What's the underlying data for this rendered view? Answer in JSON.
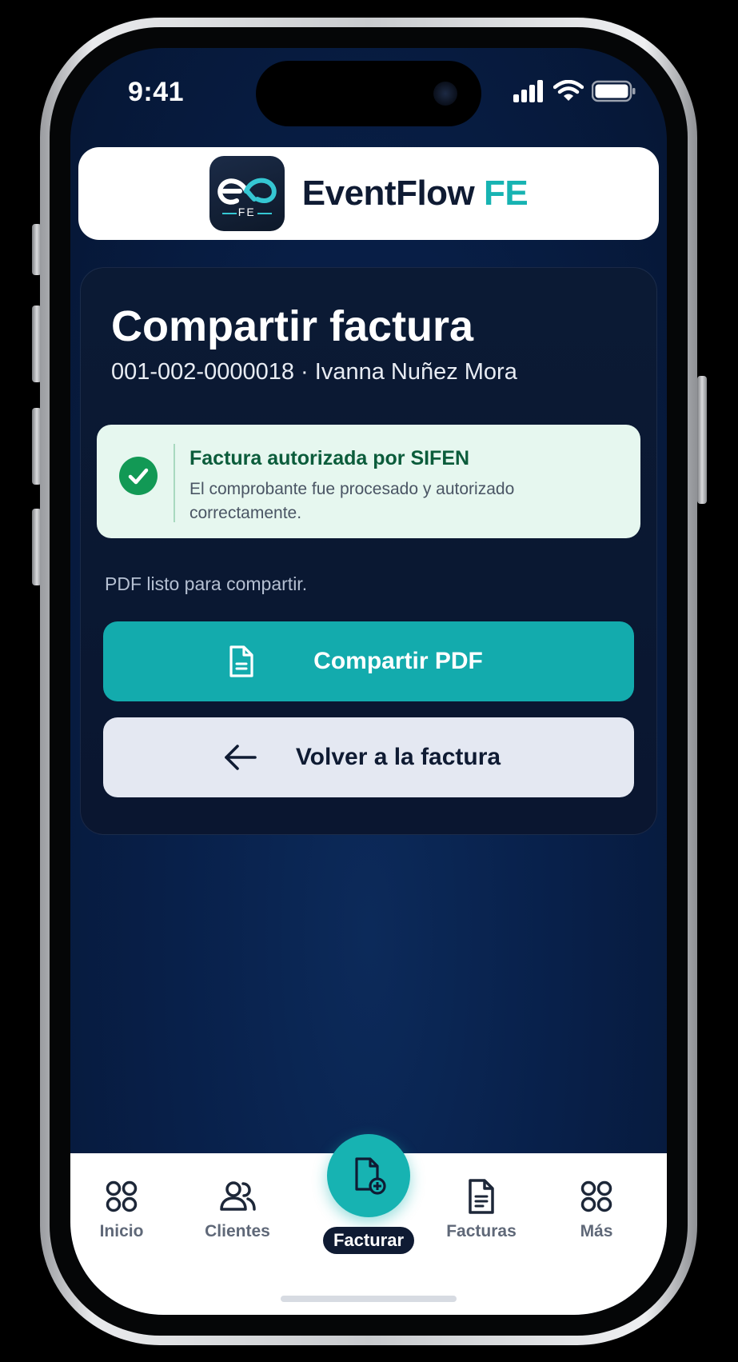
{
  "status_bar": {
    "time": "9:41",
    "icons": [
      "signal-icon",
      "wifi-icon",
      "battery-icon"
    ]
  },
  "brand": {
    "name": "EventFlow",
    "accent": "FE",
    "logo_text": "FE",
    "colors": {
      "navy": "#0f1b33",
      "teal": "#17b3b2"
    }
  },
  "page": {
    "title": "Compartir factura",
    "subtitle": "001-002-0000018 · Ivanna Nuñez Mora"
  },
  "alert": {
    "icon": "check-circle-icon",
    "title": "Factura autorizada por SIFEN",
    "message": "El comprobante fue procesado y autorizado correctamente.",
    "color": "#129955"
  },
  "ready_text": "PDF listo para compartir.",
  "actions": {
    "share_pdf": {
      "label": "Compartir PDF",
      "icon": "document-icon"
    },
    "back": {
      "label": "Volver a la factura",
      "icon": "arrow-left-icon"
    }
  },
  "bottom_nav": {
    "items": [
      {
        "label": "Inicio",
        "icon": "grid-icon"
      },
      {
        "label": "Clientes",
        "icon": "users-icon"
      },
      {
        "label": "Facturar",
        "icon": "document-add-icon",
        "active": true
      },
      {
        "label": "Facturas",
        "icon": "document-icon"
      },
      {
        "label": "Más",
        "icon": "grid-icon"
      }
    ]
  }
}
